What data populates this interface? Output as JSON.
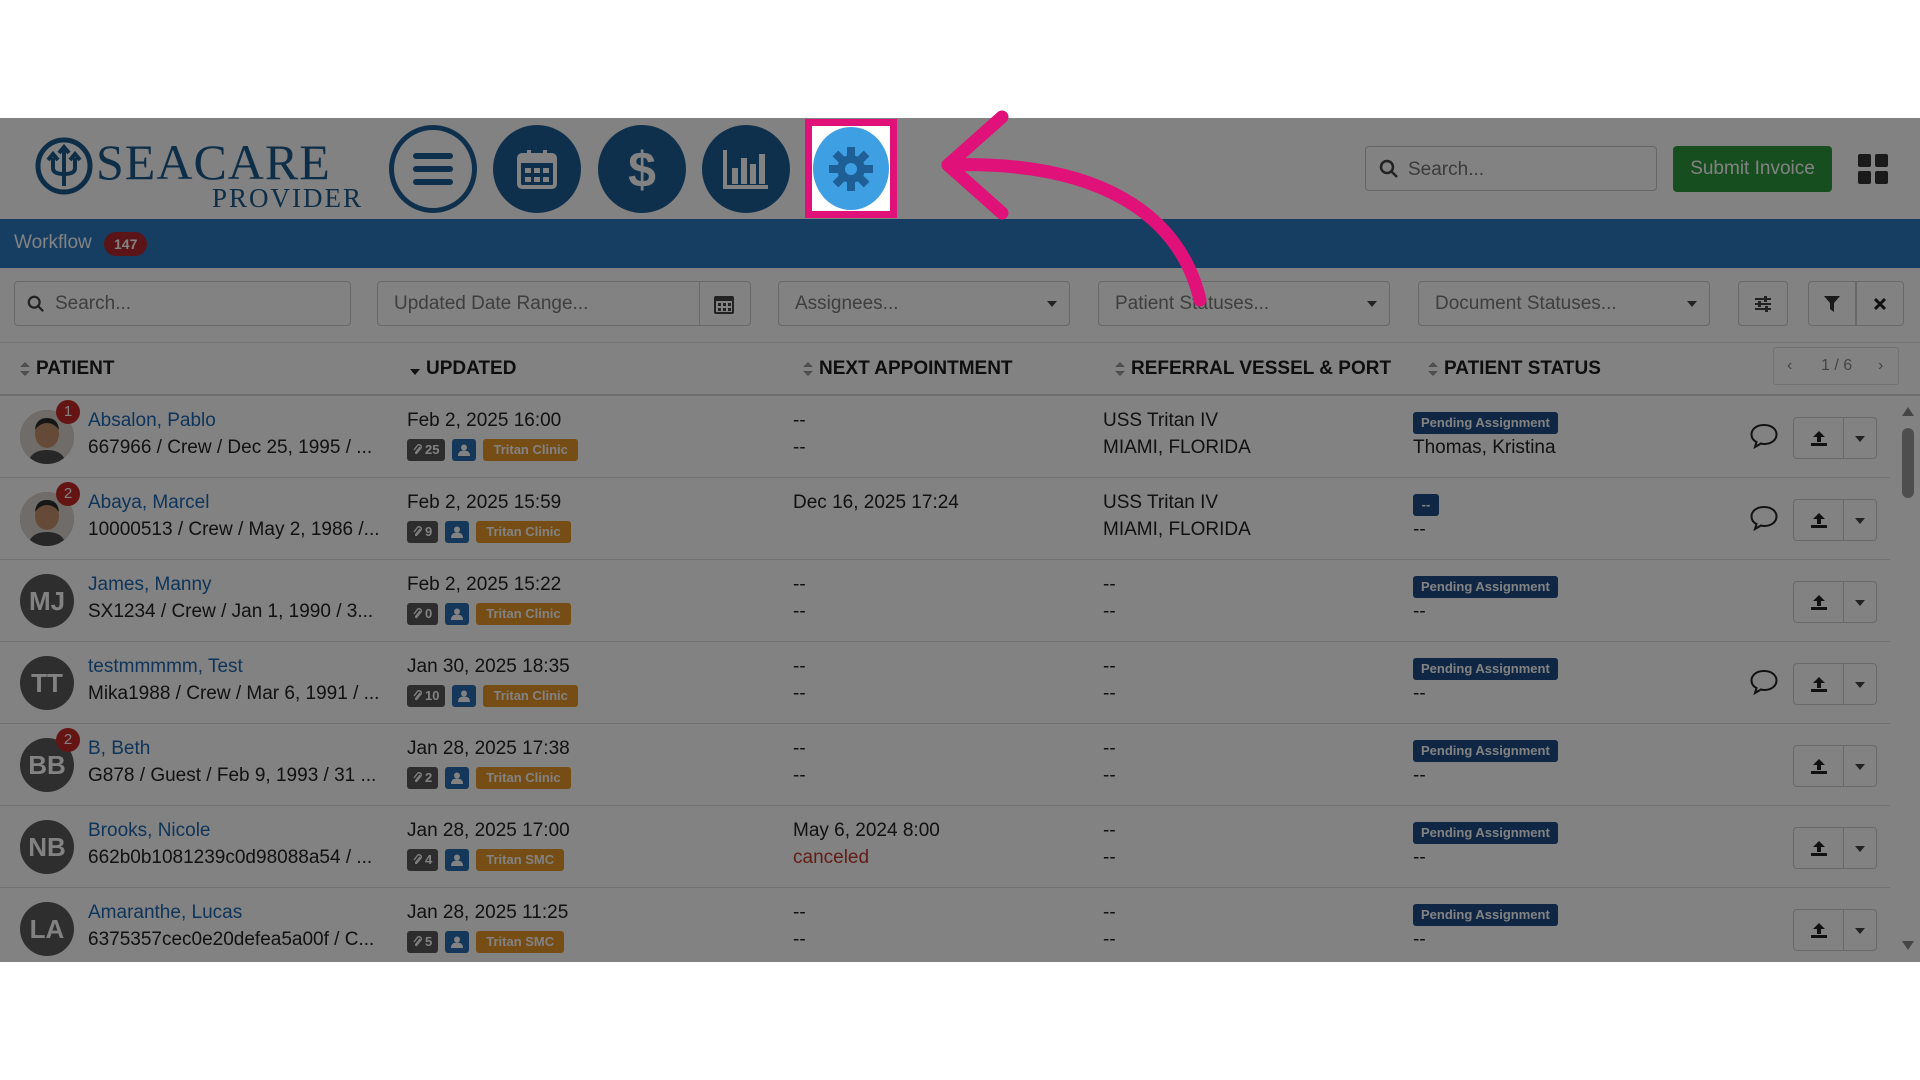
{
  "app": {
    "brand": "SEACARE",
    "brand_sub": "PROVIDER"
  },
  "colors": {
    "brand_blue": "#1f5f97",
    "bar_blue": "#2a7ac1",
    "green": "#2e9a3e",
    "highlight": "#e0127a",
    "settings_blue": "#4aa9ea",
    "clinic_orange": "#e7972a",
    "status_navy": "#1f4e86"
  },
  "nav": {
    "items": [
      {
        "icon": "menu-icon"
      },
      {
        "icon": "calendar-icon"
      },
      {
        "icon": "dollar-icon"
      },
      {
        "icon": "bar-chart-icon"
      },
      {
        "icon": "gear-icon"
      }
    ]
  },
  "search": {
    "placeholder": "Search..."
  },
  "submit_invoice_label": "Submit Invoice",
  "workflow": {
    "label": "Workflow",
    "count": "147"
  },
  "filters": {
    "search_placeholder": "Search...",
    "date_placeholder": "Updated Date Range...",
    "assignees_placeholder": "Assignees...",
    "patient_status_placeholder": "Patient Statuses...",
    "document_status_placeholder": "Document Statuses..."
  },
  "columns": {
    "patient": "PATIENT",
    "updated": "UPDATED",
    "next_appointment": "NEXT APPOINTMENT",
    "referral": "REFERRAL VESSEL & PORT",
    "patient_status": "PATIENT STATUS"
  },
  "pager": {
    "text": "1 / 6"
  },
  "rows": [
    {
      "initials": "",
      "photo": true,
      "alerts": "1",
      "name": "Absalon, Pablo",
      "meta": "667966 / Crew / Dec 25, 1995 / ...",
      "updated": "Feb 2, 2025 16:00",
      "attachments": "25",
      "clinic": "Tritan Clinic",
      "appt": "--",
      "appt2": "--",
      "vessel": "USS Tritan IV",
      "port": "MIAMI, FLORIDA",
      "status": "Pending Assignment",
      "assignee": "Thomas, Kristina",
      "chat": true
    },
    {
      "initials": "",
      "photo": true,
      "alerts": "2",
      "name": "Abaya, Marcel",
      "meta": "10000513 / Crew / May 2, 1986 /...",
      "updated": "Feb 2, 2025 15:59",
      "attachments": "9",
      "clinic": "Tritan Clinic",
      "appt": "Dec 16, 2025 17:24",
      "appt2": "",
      "vessel": "USS Tritan IV",
      "port": "MIAMI, FLORIDA",
      "status": "--",
      "assignee": "--",
      "chat": true
    },
    {
      "initials": "MJ",
      "photo": false,
      "alerts": "",
      "name": "James, Manny",
      "meta": "SX1234 / Crew / Jan 1, 1990 / 3...",
      "updated": "Feb 2, 2025 15:22",
      "attachments": "0",
      "clinic": "Tritan Clinic",
      "appt": "--",
      "appt2": "--",
      "vessel": "--",
      "port": "--",
      "status": "Pending Assignment",
      "assignee": "--",
      "chat": false
    },
    {
      "initials": "TT",
      "photo": false,
      "alerts": "",
      "name": "testmmmmm, Test",
      "meta": "Mika1988 / Crew / Mar 6, 1991 / ...",
      "updated": "Jan 30, 2025 18:35",
      "attachments": "10",
      "clinic": "Tritan Clinic",
      "appt": "--",
      "appt2": "--",
      "vessel": "--",
      "port": "--",
      "status": "Pending Assignment",
      "assignee": "--",
      "chat": true
    },
    {
      "initials": "BB",
      "photo": false,
      "alerts": "2",
      "name": "B, Beth",
      "meta": "G878 / Guest / Feb 9, 1993 / 31 ...",
      "updated": "Jan 28, 2025 17:38",
      "attachments": "2",
      "clinic": "Tritan Clinic",
      "appt": "--",
      "appt2": "--",
      "vessel": "--",
      "port": "--",
      "status": "Pending Assignment",
      "assignee": "--",
      "chat": false
    },
    {
      "initials": "NB",
      "photo": false,
      "alerts": "",
      "name": "Brooks, Nicole",
      "meta": "662b0b1081239c0d98088a54 / ...",
      "updated": "Jan 28, 2025 17:00",
      "attachments": "4",
      "clinic": "Tritan SMC",
      "appt": "May 6, 2024 8:00",
      "appt2": "canceled",
      "vessel": "--",
      "port": "--",
      "status": "Pending Assignment",
      "assignee": "--",
      "chat": false
    },
    {
      "initials": "LA",
      "photo": false,
      "alerts": "",
      "name": "Amaranthe, Lucas",
      "meta": "6375357cec0e20defea5a00f / C...",
      "updated": "Jan 28, 2025 11:25",
      "attachments": "5",
      "clinic": "Tritan SMC",
      "appt": "--",
      "appt2": "--",
      "vessel": "--",
      "port": "--",
      "status": "Pending Assignment",
      "assignee": "--",
      "chat": false
    }
  ]
}
